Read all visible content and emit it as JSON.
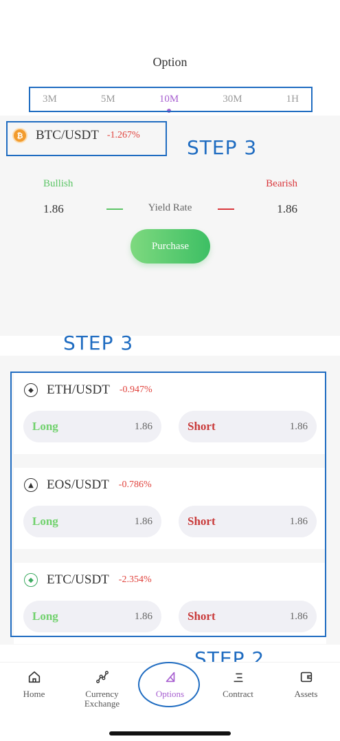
{
  "header": {
    "title": "Option"
  },
  "time_tabs": {
    "items": [
      "3M",
      "5M",
      "10M",
      "30M",
      "1H"
    ],
    "active": "10M"
  },
  "annotations": {
    "step_top": "STEP 3",
    "step_mid": "STEP 3",
    "step_bottom": "STEP 2",
    "color": "#1f6cc1"
  },
  "main": {
    "pair": "BTC/USDT",
    "change": "-1.267%",
    "bullish_label": "Bullish",
    "bearish_label": "Bearish",
    "bullish_value": "1.86",
    "bearish_value": "1.86",
    "yield_label": "Yield Rate",
    "purchase_label": "Purchase"
  },
  "list": [
    {
      "pair": "ETH/USDT",
      "change": "-0.947%",
      "long_label": "Long",
      "long_value": "1.86",
      "short_label": "Short",
      "short_value": "1.86",
      "icon": "eth-icon"
    },
    {
      "pair": "EOS/USDT",
      "change": "-0.786%",
      "long_label": "Long",
      "long_value": "1.86",
      "short_label": "Short",
      "short_value": "1.86",
      "icon": "eos-icon"
    },
    {
      "pair": "ETC/USDT",
      "change": "-2.354%",
      "long_label": "Long",
      "long_value": "1.86",
      "short_label": "Short",
      "short_value": "1.86",
      "icon": "etc-icon"
    }
  ],
  "nav": {
    "items": [
      {
        "label": "Home",
        "icon": "home-icon"
      },
      {
        "label": "Currency\nExchange",
        "icon": "exchange-icon"
      },
      {
        "label": "Options",
        "icon": "options-icon"
      },
      {
        "label": "Contract",
        "icon": "contract-icon"
      },
      {
        "label": "Assets",
        "icon": "wallet-icon"
      }
    ],
    "active": "Options"
  },
  "colors": {
    "accent": "#a75fd0",
    "bullish": "#5cc566",
    "bearish": "#d9363b",
    "negative": "#e0413b"
  }
}
